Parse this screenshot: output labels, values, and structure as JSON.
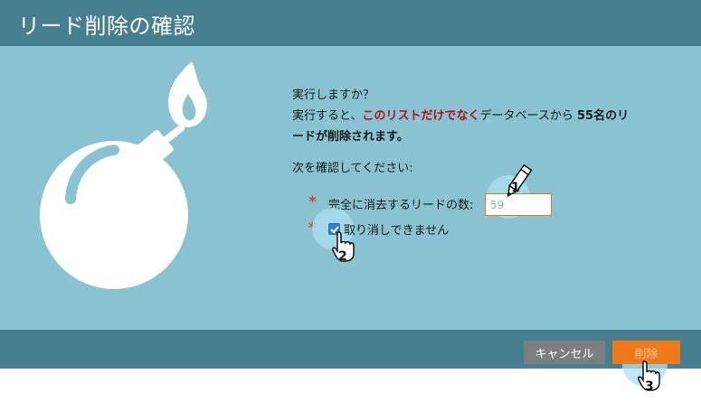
{
  "dialog": {
    "title": "リード削除の確認",
    "question": "実行しますか？",
    "message_prefix": "実行すると、",
    "message_red": "このリストだけでなく",
    "message_mid": "データベースから ",
    "message_bold_count": "55名のリ",
    "message_bold_line2": "ードが削除されます。",
    "confirm_prompt": "次を確認してください:",
    "required_mark": "*",
    "count_label": "完全に消去するリードの数:",
    "count_value": "59",
    "irreversible_label": "取り消しできません",
    "irreversible_checked": true,
    "cancel_label": "キャンセル",
    "delete_label": "削除"
  },
  "icons": {
    "main": "bomb-icon",
    "pencil": "pencil-cursor-icon",
    "hand": "hand-pointer-icon"
  },
  "steps": [
    "1",
    "2",
    "3"
  ],
  "colors": {
    "titlebar": "#467f90",
    "body": "#89c3d2",
    "delete": "#f07a1a",
    "cancel": "#7b7f81",
    "warning_red": "#b3101a"
  }
}
